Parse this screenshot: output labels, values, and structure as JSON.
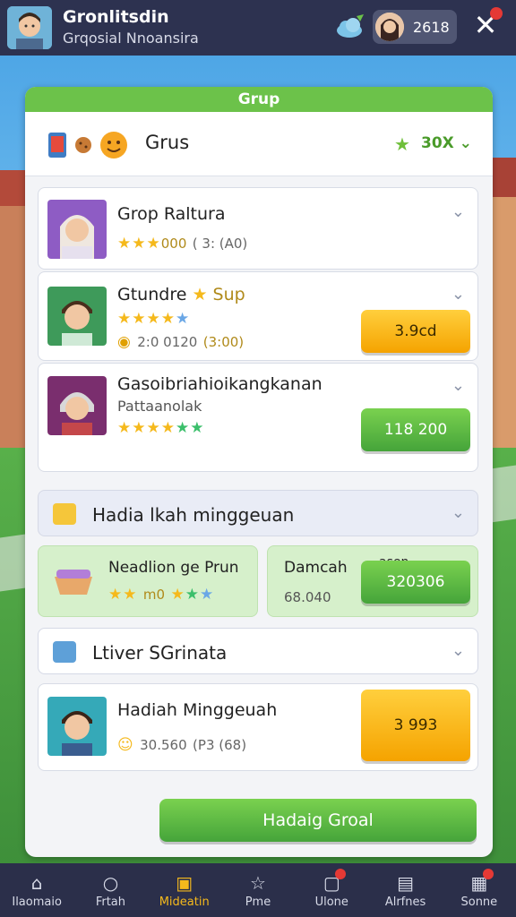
{
  "header": {
    "title": "Gronlitsdin",
    "subtitle": "Grqosial Nnoansira",
    "coins": "2618"
  },
  "panel": {
    "header": "Grup",
    "title": "Grus",
    "count": "30X"
  },
  "members": [
    {
      "name": "Grop Raltura",
      "stars_text": "000",
      "score": "( 3: (A0)",
      "button": ""
    },
    {
      "name": "Gtundre",
      "tag": "Sup",
      "score": "2:0 0120",
      "score2": "(3:00)",
      "button": "3.9cd"
    },
    {
      "name": "Gasoibriahioikangkanan",
      "sub": "Pattaanolak",
      "button": "118 200"
    }
  ],
  "weekly": {
    "title": "Hadia lkah minggeuan",
    "left_title": "Neadlion ge Prun",
    "left_stars_text": "m0",
    "right_title": "Damcah",
    "right_extra": "asen",
    "right_value": "68.040",
    "right_button": "320306"
  },
  "river": {
    "title": "Ltiver SGrinata"
  },
  "reward": {
    "title": "Hadiah Minggeuah",
    "value": "30.560",
    "value2": "(P3 (68)",
    "button": "3 993"
  },
  "bottom_button": "Hadaig Groal",
  "nav": [
    {
      "label": "Ilaomaio",
      "icon": "home-icon"
    },
    {
      "label": "Frtah",
      "icon": "search-icon"
    },
    {
      "label": "Mideatin",
      "icon": "trophy-icon"
    },
    {
      "label": "Pme",
      "icon": "star-icon"
    },
    {
      "label": "Ulone",
      "icon": "chat-icon"
    },
    {
      "label": "Alrfnes",
      "icon": "image-icon"
    },
    {
      "label": "Sonne",
      "icon": "shop-icon"
    }
  ],
  "colors": {
    "topbar": "#2d3250",
    "accent_green": "#6cc24a",
    "accent_orange": "#f5a300",
    "star": "#f5b91c"
  }
}
